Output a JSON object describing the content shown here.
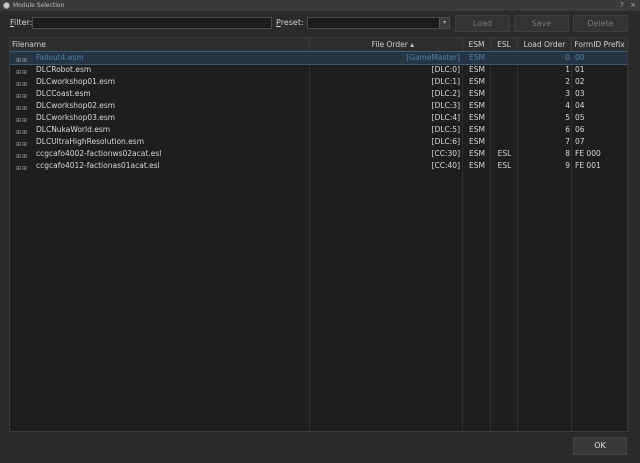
{
  "window": {
    "title": "Module Selection",
    "help_glyph": "?",
    "close_glyph": "×"
  },
  "toolbar": {
    "filter_label_u": "F",
    "filter_label_rest": "ilter:",
    "filter_value": "",
    "preset_label_u": "P",
    "preset_label_rest": "reset:",
    "preset_value": "",
    "preset_arrow": "▾",
    "load_label": "Load",
    "save_label": "Save",
    "delete_label": "Delete"
  },
  "table": {
    "headers": {
      "filename": "Filename",
      "file_order": "File Order",
      "sort_glyph": "▴",
      "esm": "ESM",
      "esl": "ESL",
      "load_order": "Load Order",
      "formid_prefix": "FormID Prefix"
    },
    "expand_glyph": "⊞⊞",
    "rows": [
      {
        "filename": "Fallout4.esm",
        "file_order": "[GameMaster]",
        "esm": "ESM",
        "esl": "",
        "load_order": "0",
        "formid": "00",
        "selected": true
      },
      {
        "filename": "DLCRobot.esm",
        "file_order": "[DLC:0]",
        "esm": "ESM",
        "esl": "",
        "load_order": "1",
        "formid": "01"
      },
      {
        "filename": "DLCworkshop01.esm",
        "file_order": "[DLC:1]",
        "esm": "ESM",
        "esl": "",
        "load_order": "2",
        "formid": "02"
      },
      {
        "filename": "DLCCoast.esm",
        "file_order": "[DLC:2]",
        "esm": "ESM",
        "esl": "",
        "load_order": "3",
        "formid": "03"
      },
      {
        "filename": "DLCworkshop02.esm",
        "file_order": "[DLC:3]",
        "esm": "ESM",
        "esl": "",
        "load_order": "4",
        "formid": "04"
      },
      {
        "filename": "DLCworkshop03.esm",
        "file_order": "[DLC:4]",
        "esm": "ESM",
        "esl": "",
        "load_order": "5",
        "formid": "05"
      },
      {
        "filename": "DLCNukaWorld.esm",
        "file_order": "[DLC:5]",
        "esm": "ESM",
        "esl": "",
        "load_order": "6",
        "formid": "06"
      },
      {
        "filename": "DLCUltraHighResolution.esm",
        "file_order": "[DLC:6]",
        "esm": "ESM",
        "esl": "",
        "load_order": "7",
        "formid": "07"
      },
      {
        "filename": "ccgcafo4002-factionws02acat.esl",
        "file_order": "[CC:30]",
        "esm": "ESM",
        "esl": "ESL",
        "load_order": "8",
        "formid": "FE 000"
      },
      {
        "filename": "ccgcafo4012-factionas01acat.esl",
        "file_order": "[CC:40]",
        "esm": "ESM",
        "esl": "ESL",
        "load_order": "9",
        "formid": "FE 001"
      }
    ]
  },
  "footer": {
    "ok_label": "OK"
  },
  "colors": {
    "background": "#2b2b2b",
    "table_bg": "#1e1e1e",
    "selection": "#263544",
    "selected_text": "#4f7fa8"
  }
}
